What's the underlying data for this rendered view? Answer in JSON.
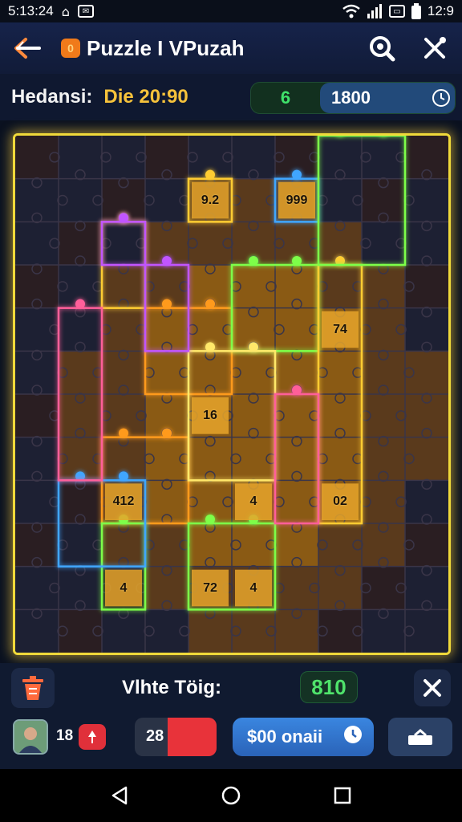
{
  "status_bar": {
    "time": "5:13:24",
    "clock_right": "12:9"
  },
  "app_bar": {
    "title": "Puzzle I VPuzah",
    "logo_glyph": "0"
  },
  "info_bar": {
    "label": "Hedansi:",
    "timer": "Die 20:90",
    "score_small": "6",
    "score_value": "1800"
  },
  "board": {
    "cols": 10,
    "rows": 12,
    "tile_labels": [
      {
        "text": "9.2",
        "col": 4,
        "row": 1
      },
      {
        "text": "999",
        "col": 6,
        "row": 1
      },
      {
        "text": "74",
        "col": 7,
        "row": 4
      },
      {
        "text": "16",
        "col": 4,
        "row": 6
      },
      {
        "text": "412",
        "col": 2,
        "row": 8
      },
      {
        "text": "4",
        "col": 5,
        "row": 8
      },
      {
        "text": "02",
        "col": 7,
        "row": 8
      },
      {
        "text": "4",
        "col": 2,
        "row": 10
      },
      {
        "text": "72",
        "col": 4,
        "row": 10
      },
      {
        "text": "4",
        "col": 5,
        "row": 10
      }
    ],
    "glow_colors": [
      "#ffcc33",
      "#ff9a1f",
      "#7dff4a",
      "#c155ff",
      "#3fa6ff",
      "#ff5e9a",
      "#ffe86a"
    ]
  },
  "bottom": {
    "label": "Vlhte Töig:",
    "count": "810",
    "player_number": "18",
    "progress_value": "28",
    "progress_fill": 0.6,
    "action_label": "$00 onaii"
  },
  "colors": {
    "accent_green": "#3fe26a",
    "accent_blue": "#3a86e0",
    "accent_red": "#e8333a",
    "timer_gold": "#f6c23b"
  }
}
